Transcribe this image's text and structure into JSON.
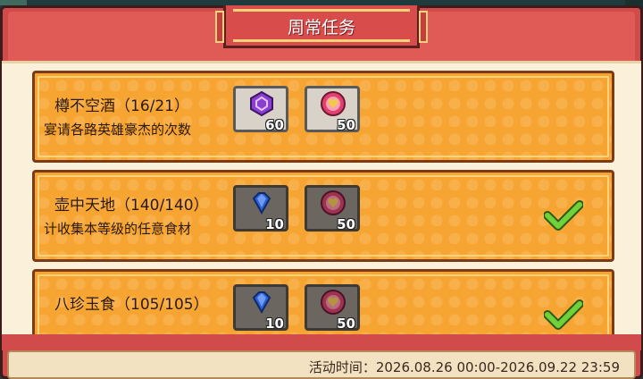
{
  "title": "周常任务",
  "tasks": [
    {
      "name": "樽不空酒",
      "progress": "（16/21）",
      "desc": "宴请各路英雄豪杰的次数",
      "rewards": [
        {
          "icon": "purple-hexagon-coin-icon",
          "qty": "60"
        },
        {
          "icon": "pink-heart-orb-icon",
          "qty": "50"
        }
      ],
      "completed": false
    },
    {
      "name": "壶中天地",
      "progress": "（140/140）",
      "desc": "计收集本等级的任意食材",
      "rewards": [
        {
          "icon": "blue-diamond-icon",
          "qty": "10"
        },
        {
          "icon": "pink-heart-orb-icon",
          "qty": "50"
        }
      ],
      "completed": true
    },
    {
      "name": "八珍玉食",
      "progress": "（105/105）",
      "desc": "",
      "rewards": [
        {
          "icon": "blue-diamond-icon",
          "qty": "10"
        },
        {
          "icon": "pink-heart-orb-icon",
          "qty": "50"
        }
      ],
      "completed": true
    }
  ],
  "event_time": "活动时间：2026.08.26 00:00-2026.09.22 23:59",
  "colors": {
    "frame_red": "#d24b4b",
    "card_orange": "#f7a532",
    "check_green": "#6fd23a"
  }
}
